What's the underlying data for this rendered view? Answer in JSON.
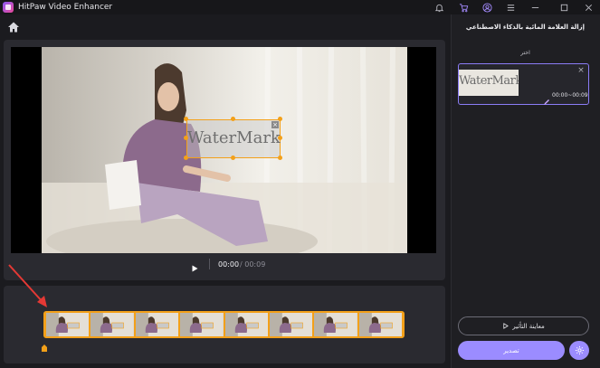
{
  "app": {
    "title": "HitPaw Video Enhancer"
  },
  "titlebar": {
    "icons": [
      "bell-icon",
      "cart-icon",
      "user-icon",
      "menu-icon",
      "minimize-icon",
      "maximize-icon",
      "close-icon"
    ]
  },
  "player": {
    "watermark_text": "WaterMark",
    "watermark_close": "×",
    "time_current": "00:00",
    "time_total": "/ 00:09"
  },
  "sidebar": {
    "title": "إزالة العلامة المائية بالذكاء الاصطناعي",
    "section_label": "اختر",
    "clip": {
      "thumb_text": "WaterMark",
      "close": "×",
      "time_range": "00:00~00:09"
    },
    "preview_button": "معاينة التأثير",
    "export_button": "تصدير"
  },
  "colors": {
    "accent": "#9b8cff",
    "selection": "#f3a019",
    "background": "#1b1b1f",
    "panel": "#2a2a30",
    "arrow": "#e53935"
  }
}
